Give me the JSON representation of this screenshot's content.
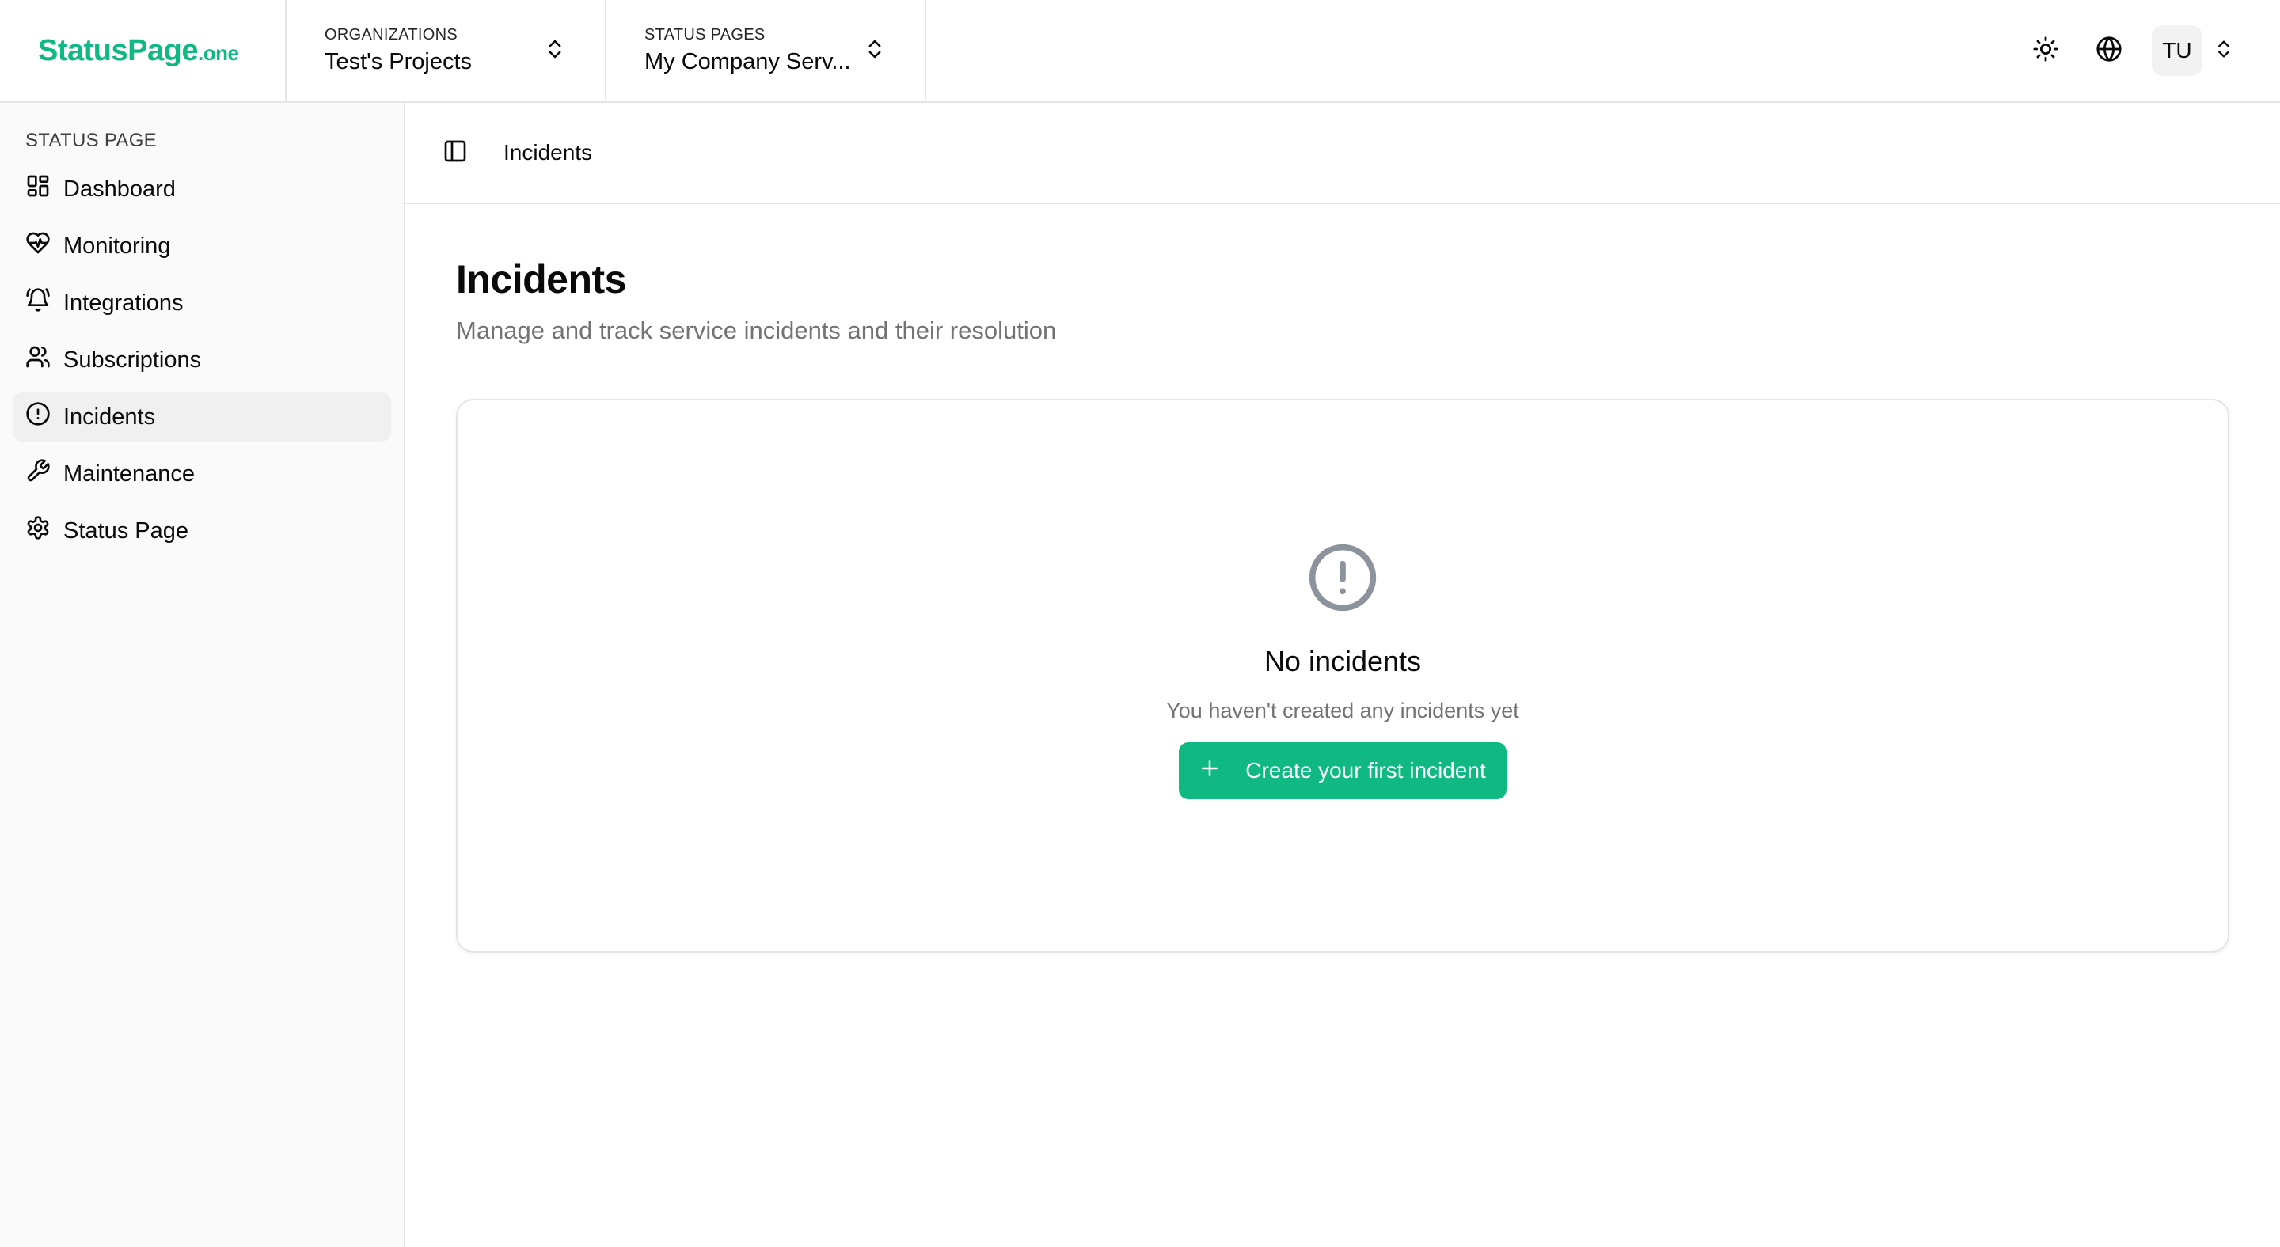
{
  "brand": {
    "name": "StatusPage",
    "tld": ".one",
    "color": "#10b981"
  },
  "header": {
    "organization": {
      "label": "ORGANIZATIONS",
      "value": "Test's Projects"
    },
    "status_page": {
      "label": "STATUS PAGES",
      "value": "My Company Serv..."
    },
    "user_initials": "TU",
    "icons": [
      "sun-icon",
      "globe-icon",
      "chevron-up-down-icon"
    ]
  },
  "sidebar": {
    "group_label": "STATUS PAGE",
    "items": [
      {
        "label": "Dashboard",
        "icon": "dashboard-icon"
      },
      {
        "label": "Monitoring",
        "icon": "heart-pulse-icon"
      },
      {
        "label": "Integrations",
        "icon": "bell-ring-icon"
      },
      {
        "label": "Subscriptions",
        "icon": "users-icon"
      },
      {
        "label": "Incidents",
        "icon": "alert-circle-icon",
        "active": true
      },
      {
        "label": "Maintenance",
        "icon": "wrench-icon"
      },
      {
        "label": "Status Page",
        "icon": "settings-gear-icon"
      }
    ]
  },
  "main": {
    "breadcrumb": "Incidents",
    "title": "Incidents",
    "subtitle": "Manage and track service incidents and their resolution",
    "empty_state": {
      "icon": "alert-circle-icon",
      "title": "No incidents",
      "description": "You haven't created any incidents yet",
      "button_label": "Create your first incident"
    }
  }
}
